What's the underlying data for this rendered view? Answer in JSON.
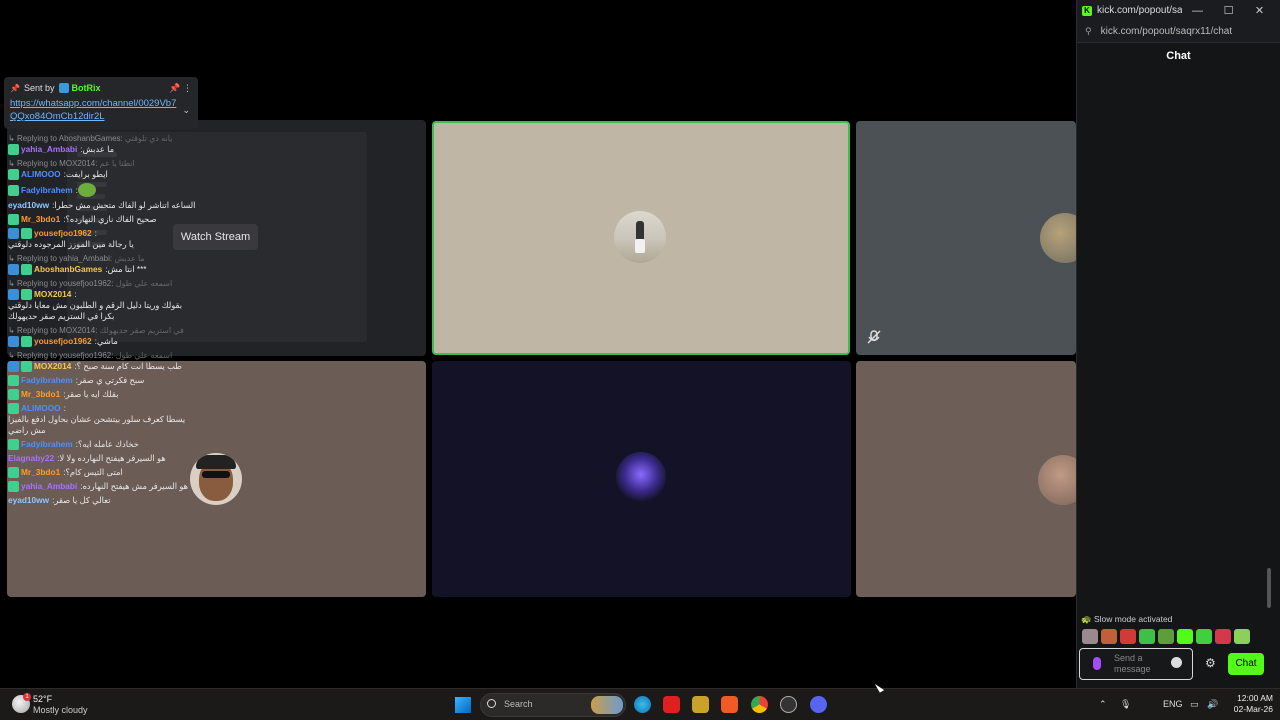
{
  "video_call": {
    "watch_stream_label": "Watch Stream"
  },
  "chat_window": {
    "title": "kick.com/popout/saqr...",
    "url": "kick.com/popout/saqrx11/chat",
    "header": "Chat",
    "window_controls": [
      "—",
      "☐",
      "✕"
    ],
    "pinned": {
      "sent_by_label": "Sent by",
      "sender": "BotRix",
      "link": "https://whatsapp.com/channel/0029Vb7QQxo84OmCb12dir2L"
    },
    "messages": [
      {
        "reply_to": "Replying to AboshanbGames:",
        "reply_text": "يانه دي تلوقتي",
        "badges": [
          "green"
        ],
        "user": "yahia_Ambabi",
        "user_color": "#a970ff",
        "text": "ما عدبش"
      },
      {
        "reply_to": "Replying to MOX2014:",
        "reply_text": "انطتا يا عم",
        "badges": [
          "green"
        ],
        "user": "ALIMOOO",
        "user_color": "#4d8fff",
        "text": "ايطو برايفت"
      },
      {
        "reply_to": "",
        "reply_text": "",
        "badges": [
          "green"
        ],
        "user": "Fadyibrahem",
        "user_color": "#4d8fff",
        "text": "",
        "emote": true
      },
      {
        "reply_to": "",
        "reply_text": "",
        "badges": [],
        "user": "eyad10ww",
        "user_color": "#8fc8ff",
        "text": "الساعه اتناشر لو الفاك متحش مش حطرا"
      },
      {
        "reply_to": "",
        "reply_text": "",
        "badges": [
          "green"
        ],
        "user": "Mr_3bdo1",
        "user_color": "#ff9b28",
        "text": "صحيح الفاك نازي النهارده؟"
      },
      {
        "reply_to": "",
        "reply_text": "",
        "badges": [
          "blue",
          "green"
        ],
        "user": "yousefjoo1962",
        "user_color": "#ff9b28",
        "text": "يا رجالة مين الموزز المرجوده دلوقتي"
      },
      {
        "reply_to": "Replying to yahia_Ambabi:",
        "reply_text": "ما عدبش",
        "badges": [
          "blue",
          "green"
        ],
        "user": "AboshanbGames",
        "user_color": "#f7c948",
        "text": "انتا مش ***"
      },
      {
        "reply_to": "Replying to yousefjoo1962:",
        "reply_text": "اسمعه علي طول",
        "badges": [
          "blue",
          "green"
        ],
        "user": "MOX2014",
        "user_color": "#f7c948",
        "text": "بقولك وريتا دليل الرقم و الطلبون مش معايا دلوقتي بكرا في الستريم صقر حديهولك"
      },
      {
        "reply_to": "Replying to MOX2014:",
        "reply_text": "في استريم صقر حديهولك",
        "badges": [
          "blue",
          "green"
        ],
        "user": "yousefjoo1962",
        "user_color": "#ff9b28",
        "text": "ماشي"
      },
      {
        "reply_to": "Replying to yousefjoo1962:",
        "reply_text": "اسمعه علي طول",
        "badges": [
          "blue",
          "green"
        ],
        "user": "MOX2014",
        "user_color": "#f7c948",
        "text": "طب يسطا انت كام سنة صبح ؟"
      },
      {
        "reply_to": "",
        "reply_text": "",
        "badges": [
          "green"
        ],
        "user": "Fadyibrahem",
        "user_color": "#4d8fff",
        "text": "سبح فكرتي ي صقر"
      },
      {
        "reply_to": "",
        "reply_text": "",
        "badges": [
          "green"
        ],
        "user": "Mr_3bdo1",
        "user_color": "#ff9b28",
        "text": "بقلك ايه يا صقر"
      },
      {
        "reply_to": "",
        "reply_text": "",
        "badges": [
          "green"
        ],
        "user": "ALIMOOO",
        "user_color": "#4d8fff",
        "text": "يسطا كعرف سلور بيتشحن عشان بحاول ادفع بالفيزا مش راضي"
      },
      {
        "reply_to": "",
        "reply_text": "",
        "badges": [
          "green"
        ],
        "user": "Fadyibrahem",
        "user_color": "#4d8fff",
        "text": "خخادك عامله ايه؟"
      },
      {
        "reply_to": "",
        "reply_text": "",
        "badges": [],
        "user": "Elagnaby22",
        "user_color": "#a970ff",
        "text": "هو السيرفر هيفتح النهارده ولا لا"
      },
      {
        "reply_to": "",
        "reply_text": "",
        "badges": [
          "green"
        ],
        "user": "Mr_3bdo1",
        "user_color": "#ff9b28",
        "text": "امتى التيس كام؟"
      },
      {
        "reply_to": "",
        "reply_text": "",
        "badges": [
          "green"
        ],
        "user": "yahia_Ambabi",
        "user_color": "#a970ff",
        "text": "هو السيرفر مش هيفتح النهارده"
      },
      {
        "reply_to": "",
        "reply_text": "",
        "badges": [],
        "user": "eyad10ww",
        "user_color": "#8fc8ff",
        "text": "تعالي كل يا صقر"
      }
    ],
    "slow_mode": "Slow mode activated",
    "input_placeholder": "Send a message",
    "send_label": "Chat"
  },
  "taskbar": {
    "weather_temp": "52°F",
    "weather_desc": "Mostly cloudy",
    "weather_badge": "1",
    "search_label": "Search",
    "language": "ENG",
    "time": "12:00 AM",
    "date": "02-Mar-26"
  },
  "colors": {
    "kick_green": "#53fc18",
    "speaking_border": "#3fbf4a"
  }
}
